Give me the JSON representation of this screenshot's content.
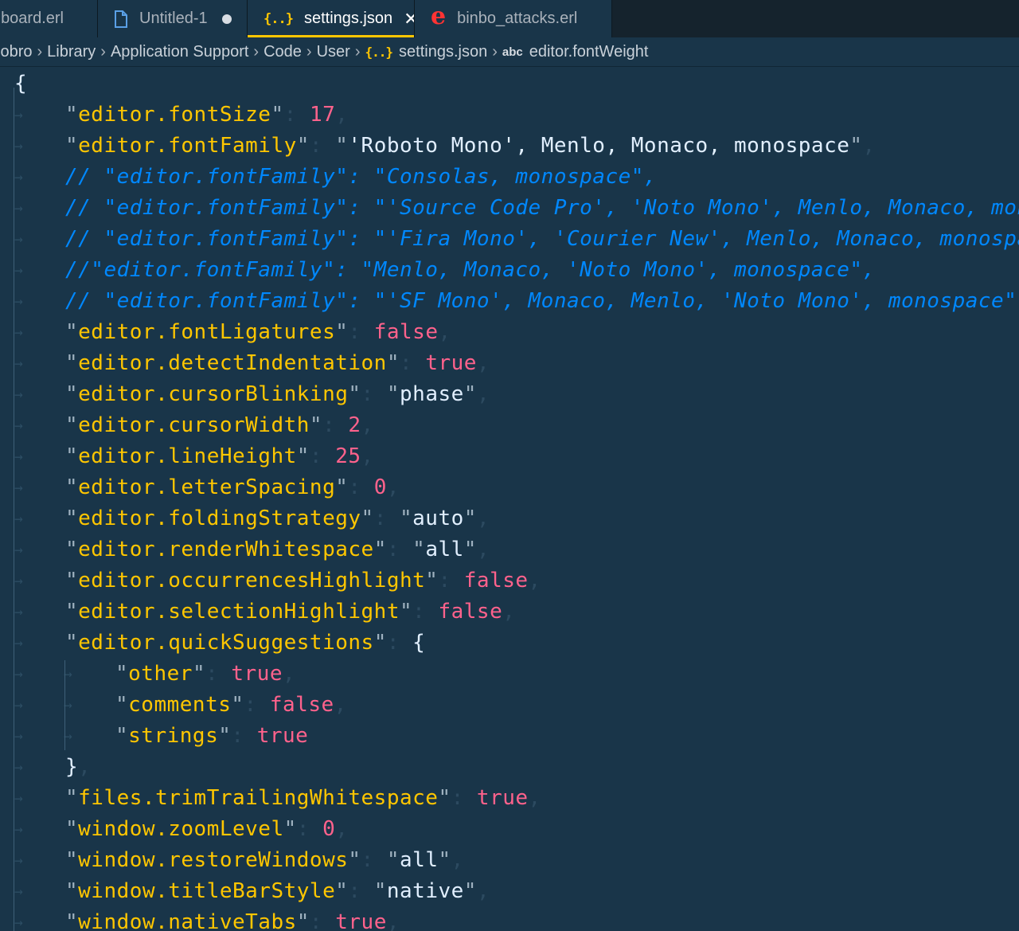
{
  "tabs": [
    {
      "label": "board.erl",
      "icon": "erlang-file-icon",
      "state": "normal"
    },
    {
      "label": "Untitled-1",
      "icon": "file-icon",
      "state": "modified"
    },
    {
      "label": "settings.json",
      "icon": "json-icon",
      "state": "active"
    },
    {
      "label": "binbo_attacks.erl",
      "icon": "erlang-file-icon",
      "state": "normal"
    }
  ],
  "breadcrumb": {
    "items": [
      "lobro",
      "Library",
      "Application Support",
      "Code",
      "User",
      "settings.json",
      "editor.fontWeight"
    ],
    "json_glyph": "{..}",
    "symbol_glyph": "abc"
  },
  "glyphs": {
    "json": "{..}",
    "close": "✕",
    "separator": "›",
    "arrow": "→"
  },
  "code": {
    "lines": [
      {
        "indent": 0,
        "tokens": [
          [
            "brace",
            "{"
          ]
        ]
      },
      {
        "indent": 1,
        "tokens": [
          [
            "q",
            "\""
          ],
          [
            "key",
            "editor.fontSize"
          ],
          [
            "q",
            "\""
          ],
          [
            "colon",
            ": "
          ],
          [
            "num",
            "17"
          ],
          [
            "punct",
            ","
          ]
        ]
      },
      {
        "indent": 1,
        "tokens": [
          [
            "q",
            "\""
          ],
          [
            "key",
            "editor.fontFamily"
          ],
          [
            "q",
            "\""
          ],
          [
            "colon",
            ": "
          ],
          [
            "q",
            "\""
          ],
          [
            "str",
            "'Roboto Mono', Menlo, Monaco, monospace"
          ],
          [
            "q",
            "\""
          ],
          [
            "punct",
            ","
          ]
        ]
      },
      {
        "indent": 1,
        "tokens": [
          [
            "comment",
            "// \"editor.fontFamily\": \"Consolas, monospace\","
          ]
        ]
      },
      {
        "indent": 1,
        "tokens": [
          [
            "comment",
            "// \"editor.fontFamily\": \"'Source Code Pro', 'Noto Mono', Menlo, Monaco, monospace\","
          ]
        ]
      },
      {
        "indent": 1,
        "tokens": [
          [
            "comment",
            "// \"editor.fontFamily\": \"'Fira Mono', 'Courier New', Menlo, Monaco, monospace\","
          ]
        ]
      },
      {
        "indent": 1,
        "tokens": [
          [
            "comment",
            "//\"editor.fontFamily\": \"Menlo, Monaco, 'Noto Mono', monospace\","
          ]
        ]
      },
      {
        "indent": 1,
        "tokens": [
          [
            "comment",
            "// \"editor.fontFamily\": \"'SF Mono', Monaco, Menlo, 'Noto Mono', monospace\","
          ]
        ]
      },
      {
        "indent": 1,
        "tokens": [
          [
            "q",
            "\""
          ],
          [
            "key",
            "editor.fontLigatures"
          ],
          [
            "q",
            "\""
          ],
          [
            "colon",
            ": "
          ],
          [
            "num",
            "false"
          ],
          [
            "punct",
            ","
          ]
        ]
      },
      {
        "indent": 1,
        "tokens": [
          [
            "q",
            "\""
          ],
          [
            "key",
            "editor.detectIndentation"
          ],
          [
            "q",
            "\""
          ],
          [
            "colon",
            ": "
          ],
          [
            "num",
            "true"
          ],
          [
            "punct",
            ","
          ]
        ]
      },
      {
        "indent": 1,
        "tokens": [
          [
            "q",
            "\""
          ],
          [
            "key",
            "editor.cursorBlinking"
          ],
          [
            "q",
            "\""
          ],
          [
            "colon",
            ": "
          ],
          [
            "q",
            "\""
          ],
          [
            "str",
            "phase"
          ],
          [
            "q",
            "\""
          ],
          [
            "punct",
            ","
          ]
        ]
      },
      {
        "indent": 1,
        "tokens": [
          [
            "q",
            "\""
          ],
          [
            "key",
            "editor.cursorWidth"
          ],
          [
            "q",
            "\""
          ],
          [
            "colon",
            ": "
          ],
          [
            "num",
            "2"
          ],
          [
            "punct",
            ","
          ]
        ]
      },
      {
        "indent": 1,
        "tokens": [
          [
            "q",
            "\""
          ],
          [
            "key",
            "editor.lineHeight"
          ],
          [
            "q",
            "\""
          ],
          [
            "colon",
            ": "
          ],
          [
            "num",
            "25"
          ],
          [
            "punct",
            ","
          ]
        ]
      },
      {
        "indent": 1,
        "tokens": [
          [
            "q",
            "\""
          ],
          [
            "key",
            "editor.letterSpacing"
          ],
          [
            "q",
            "\""
          ],
          [
            "colon",
            ": "
          ],
          [
            "num",
            "0"
          ],
          [
            "punct",
            ","
          ]
        ]
      },
      {
        "indent": 1,
        "tokens": [
          [
            "q",
            "\""
          ],
          [
            "key",
            "editor.foldingStrategy"
          ],
          [
            "q",
            "\""
          ],
          [
            "colon",
            ": "
          ],
          [
            "q",
            "\""
          ],
          [
            "str",
            "auto"
          ],
          [
            "q",
            "\""
          ],
          [
            "punct",
            ","
          ]
        ]
      },
      {
        "indent": 1,
        "tokens": [
          [
            "q",
            "\""
          ],
          [
            "key",
            "editor.renderWhitespace"
          ],
          [
            "q",
            "\""
          ],
          [
            "colon",
            ": "
          ],
          [
            "q",
            "\""
          ],
          [
            "str",
            "all"
          ],
          [
            "q",
            "\""
          ],
          [
            "punct",
            ","
          ]
        ]
      },
      {
        "indent": 1,
        "tokens": [
          [
            "q",
            "\""
          ],
          [
            "key",
            "editor.occurrencesHighlight"
          ],
          [
            "q",
            "\""
          ],
          [
            "colon",
            ": "
          ],
          [
            "num",
            "false"
          ],
          [
            "punct",
            ","
          ]
        ]
      },
      {
        "indent": 1,
        "tokens": [
          [
            "q",
            "\""
          ],
          [
            "key",
            "editor.selectionHighlight"
          ],
          [
            "q",
            "\""
          ],
          [
            "colon",
            ": "
          ],
          [
            "num",
            "false"
          ],
          [
            "punct",
            ","
          ]
        ]
      },
      {
        "indent": 1,
        "tokens": [
          [
            "q",
            "\""
          ],
          [
            "key",
            "editor.quickSuggestions"
          ],
          [
            "q",
            "\""
          ],
          [
            "colon",
            ": "
          ],
          [
            "brace",
            "{"
          ]
        ]
      },
      {
        "indent": 2,
        "tokens": [
          [
            "q",
            "\""
          ],
          [
            "key",
            "other"
          ],
          [
            "q",
            "\""
          ],
          [
            "colon",
            ": "
          ],
          [
            "num",
            "true"
          ],
          [
            "punct",
            ","
          ]
        ]
      },
      {
        "indent": 2,
        "tokens": [
          [
            "q",
            "\""
          ],
          [
            "key",
            "comments"
          ],
          [
            "q",
            "\""
          ],
          [
            "colon",
            ": "
          ],
          [
            "num",
            "false"
          ],
          [
            "punct",
            ","
          ]
        ]
      },
      {
        "indent": 2,
        "tokens": [
          [
            "q",
            "\""
          ],
          [
            "key",
            "strings"
          ],
          [
            "q",
            "\""
          ],
          [
            "colon",
            ": "
          ],
          [
            "num",
            "true"
          ]
        ]
      },
      {
        "indent": 1,
        "tokens": [
          [
            "brace",
            "}"
          ],
          [
            "punct",
            ","
          ]
        ]
      },
      {
        "indent": 1,
        "tokens": [
          [
            "q",
            "\""
          ],
          [
            "key",
            "files.trimTrailingWhitespace"
          ],
          [
            "q",
            "\""
          ],
          [
            "colon",
            ": "
          ],
          [
            "num",
            "true"
          ],
          [
            "punct",
            ","
          ]
        ]
      },
      {
        "indent": 1,
        "tokens": [
          [
            "q",
            "\""
          ],
          [
            "key",
            "window.zoomLevel"
          ],
          [
            "q",
            "\""
          ],
          [
            "colon",
            ": "
          ],
          [
            "num",
            "0"
          ],
          [
            "punct",
            ","
          ]
        ]
      },
      {
        "indent": 1,
        "tokens": [
          [
            "q",
            "\""
          ],
          [
            "key",
            "window.restoreWindows"
          ],
          [
            "q",
            "\""
          ],
          [
            "colon",
            ": "
          ],
          [
            "q",
            "\""
          ],
          [
            "str",
            "all"
          ],
          [
            "q",
            "\""
          ],
          [
            "punct",
            ","
          ]
        ]
      },
      {
        "indent": 1,
        "tokens": [
          [
            "q",
            "\""
          ],
          [
            "key",
            "window.titleBarStyle"
          ],
          [
            "q",
            "\""
          ],
          [
            "colon",
            ": "
          ],
          [
            "q",
            "\""
          ],
          [
            "str",
            "native"
          ],
          [
            "q",
            "\""
          ],
          [
            "punct",
            ","
          ]
        ]
      },
      {
        "indent": 1,
        "tokens": [
          [
            "q",
            "\""
          ],
          [
            "key",
            "window.nativeTabs"
          ],
          [
            "q",
            "\""
          ],
          [
            "colon",
            ": "
          ],
          [
            "num",
            "true"
          ],
          [
            "punct",
            ","
          ]
        ]
      }
    ]
  },
  "colors": {
    "background": "#193549",
    "tab_bar": "#15232d",
    "accent": "#ffc600",
    "key": "#ffc600",
    "string": "#e1efff",
    "number": "#ff628c",
    "comment": "#0088ff",
    "punctuation": "#2c4a60"
  }
}
